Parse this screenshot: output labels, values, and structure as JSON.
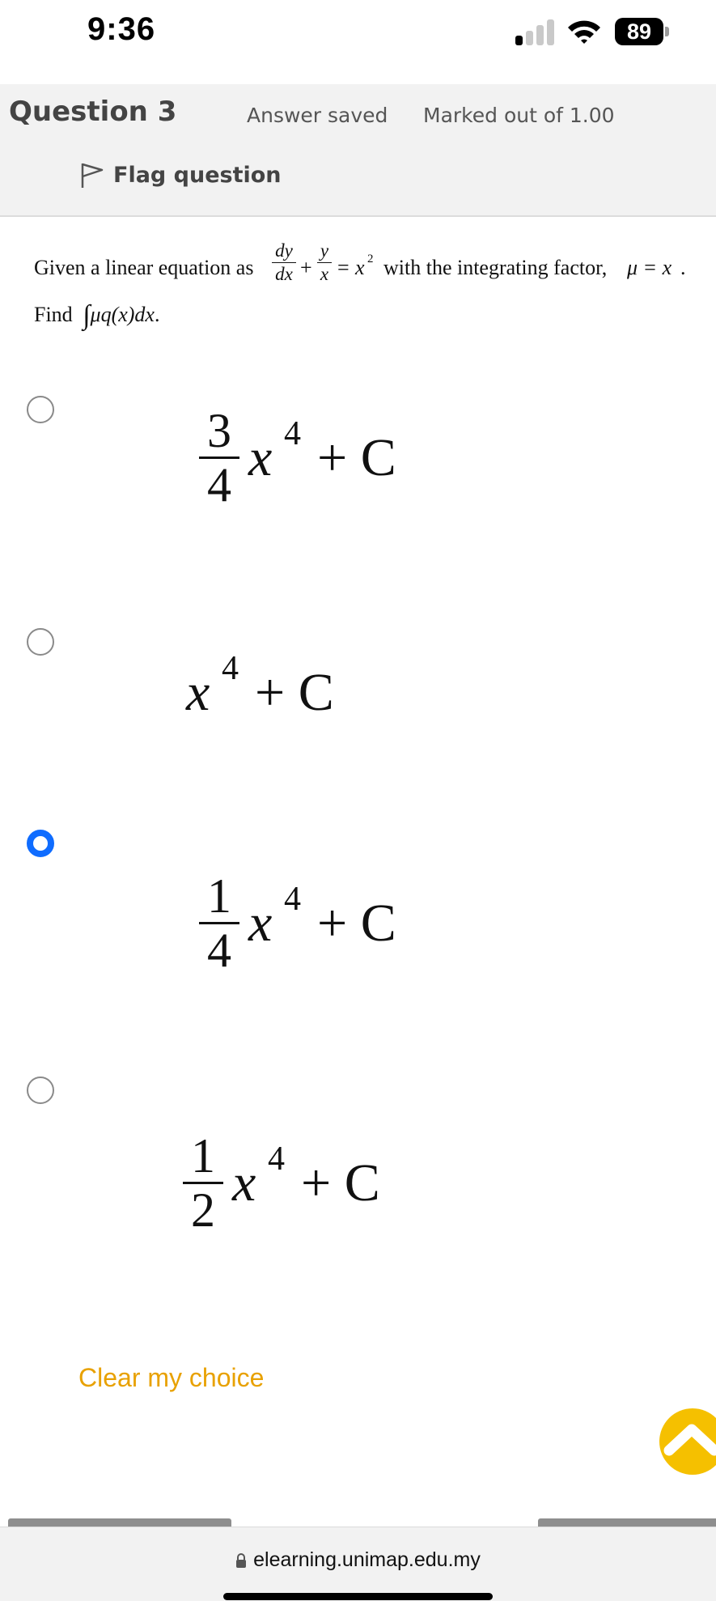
{
  "status_bar": {
    "time": "9:36",
    "battery": "89"
  },
  "question": {
    "title": "Question 3",
    "state": "Answer saved",
    "grade": "Marked out of 1.00",
    "flag_label": "Flag question",
    "text": {
      "given": "Given a linear equation as",
      "dy": "dy",
      "dx": "dx",
      "y": "y",
      "x": "x",
      "plus": "+",
      "equals": "=",
      "x2": "x",
      "with": "with the integrating factor,",
      "mu_eq": "μ = x",
      "period": ".",
      "find": "Find",
      "integral": "∫",
      "integrand": "μq(x)dx"
    }
  },
  "options": [
    {
      "num": "3",
      "den": "4",
      "var": "x",
      "exp": "4",
      "tail": "+ C",
      "selected": false
    },
    {
      "num": "",
      "den": "",
      "var": "x",
      "exp": "4",
      "tail": "+ C",
      "selected": false
    },
    {
      "num": "1",
      "den": "4",
      "var": "x",
      "exp": "4",
      "tail": "+ C",
      "selected": true
    },
    {
      "num": "1",
      "den": "2",
      "var": "x",
      "exp": "4",
      "tail": "+ C",
      "selected": false
    }
  ],
  "clear_choice": "Clear my choice",
  "browser": {
    "url": "elearning.unimap.edu.my"
  },
  "colors": {
    "accent_blue": "#0f6cff",
    "link_orange": "#e8a100",
    "scroll_button": "#f5c000"
  }
}
